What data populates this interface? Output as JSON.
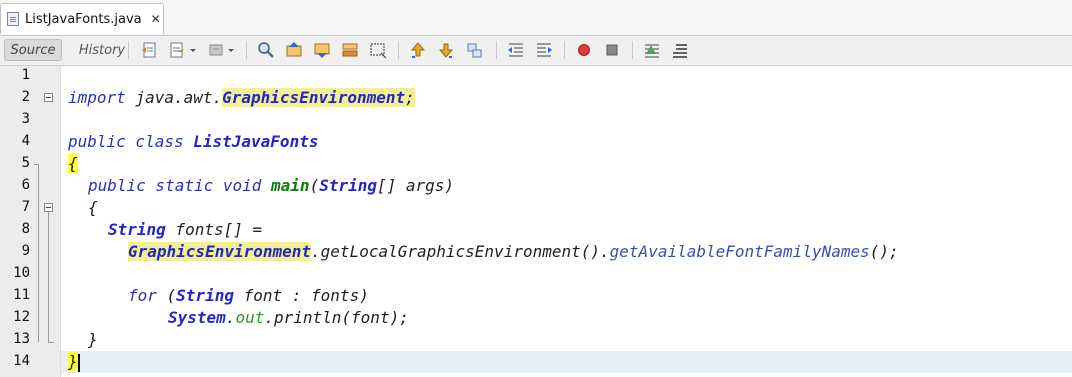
{
  "tab": {
    "title": "ListJavaFonts.java",
    "close": "✕"
  },
  "toolbar": {
    "source_label": "Source",
    "history_label": "History"
  },
  "line_numbers": [
    "1",
    "2",
    "3",
    "4",
    "5",
    "6",
    "7",
    "8",
    "9",
    "10",
    "11",
    "12",
    "13",
    "14"
  ],
  "code": {
    "l2": {
      "kw": "import",
      "pkg": " java.awt.",
      "cls": "GraphicsEnvironment",
      "end": ";"
    },
    "l4": {
      "kw": "public class ",
      "cls": "ListJavaFonts"
    },
    "l5": {
      "brace": "{"
    },
    "l6": {
      "kw": "public static void ",
      "mth": "main",
      "open": "(",
      "cls": "String",
      "rest": "[] args)"
    },
    "l7": {
      "brace": "{"
    },
    "l8": {
      "cls": "String",
      "rest": " fonts[] ="
    },
    "l9": {
      "cls": "GraphicsEnvironment",
      "call1": ".getLocalGraphicsEnvironment().",
      "call2": "getAvailableFontFamilyNames",
      "end": "();"
    },
    "l11": {
      "kw": "for",
      "open": " (",
      "cls": "String",
      "rest": " font : fonts)"
    },
    "l12": {
      "cls": "System",
      "dot": ".",
      "fld": "out",
      "rest": ".println(font);"
    },
    "l13": {
      "brace": "}"
    },
    "l14": {
      "brace": "}"
    }
  }
}
